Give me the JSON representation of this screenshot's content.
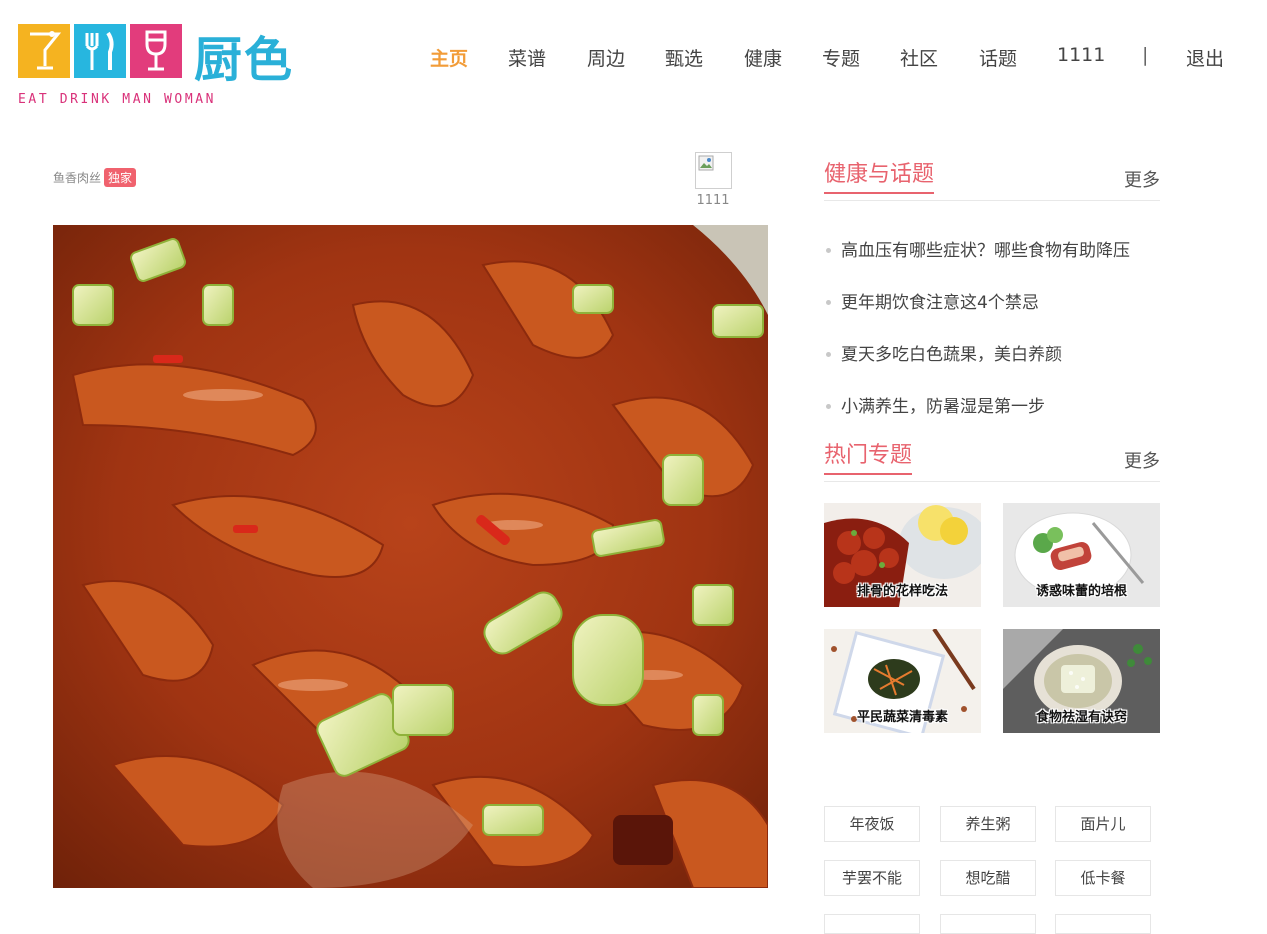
{
  "header": {
    "brand_cn": "厨色",
    "brand_en": "EAT DRINK MAN WOMAN",
    "nav": [
      {
        "label": "主页",
        "active": true
      },
      {
        "label": "菜谱"
      },
      {
        "label": "周边"
      },
      {
        "label": "甄选"
      },
      {
        "label": "健康"
      },
      {
        "label": "专题"
      },
      {
        "label": "社区"
      },
      {
        "label": "话题"
      },
      {
        "label": "1111"
      },
      {
        "label": "|"
      },
      {
        "label": "退出"
      }
    ],
    "colors": {
      "active": "#f29c38",
      "tile_yellow": "#f5b320",
      "tile_blue": "#27b6df",
      "tile_pink": "#e23c7c"
    }
  },
  "article": {
    "title": "鱼香肉丝",
    "badge": "独家",
    "author": "1111",
    "photo": "yuxiang-rousi-dish-photo"
  },
  "sidebar": {
    "health": {
      "title": "健康与话题",
      "more": "更多",
      "items": [
        "高血压有哪些症状？哪些食物有助降压",
        "更年期饮食注意这4个禁忌",
        "夏天多吃白色蔬果，美白养颜",
        "小满养生，防暑湿是第一步"
      ]
    },
    "hot": {
      "title": "热门专题",
      "more": "更多",
      "thumbs": [
        "排骨的花样吃法",
        "诱惑味蕾的培根",
        "平民蔬菜清毒素",
        "食物祛湿有诀窍"
      ]
    },
    "tags": [
      "年夜饭",
      "养生粥",
      "面片儿",
      "芋罢不能",
      "想吃醋",
      "低卡餐",
      "",
      "",
      ""
    ],
    "accent": "#e8636e"
  }
}
